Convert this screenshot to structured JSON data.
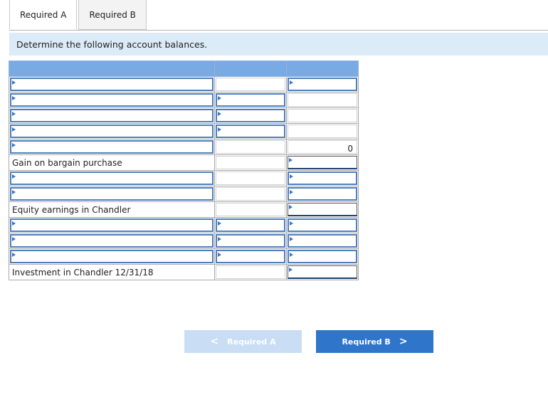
{
  "tabs": [
    {
      "label": "Required A"
    },
    {
      "label": "Required B"
    }
  ],
  "instruction": "Determine the following account balances.",
  "rows": [
    {
      "label": ""
    },
    {
      "label": ""
    },
    {
      "label": ""
    },
    {
      "label": ""
    },
    {
      "label": "",
      "value": "0"
    },
    {
      "label": "Gain on bargain purchase"
    },
    {
      "label": ""
    },
    {
      "label": ""
    },
    {
      "label": "Equity earnings in Chandler"
    },
    {
      "label": ""
    },
    {
      "label": ""
    },
    {
      "label": ""
    },
    {
      "label": "Investment in Chandler 12/31/18"
    }
  ],
  "nav": {
    "prev_label": "Required A",
    "next_label": "Required B",
    "prev_chevron": "<",
    "next_chevron": ">"
  }
}
